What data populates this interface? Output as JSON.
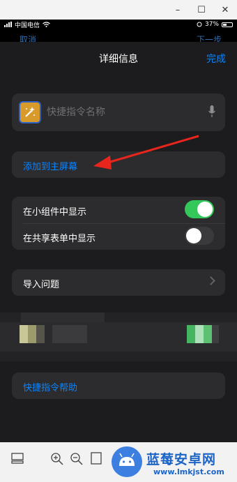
{
  "window": {
    "minimize": "–",
    "maximize": "☐",
    "close": "✕"
  },
  "status": {
    "carrier": "中国电信",
    "battery": "37%"
  },
  "behind": {
    "left": "取消",
    "right": "下一步"
  },
  "sheet": {
    "title": "详细信息",
    "done": "完成",
    "name_placeholder": "快捷指令名称",
    "add_home": "添加到主屏幕",
    "show_widget": "在小组件中显示",
    "show_widget_on": true,
    "show_share": "在共享表单中显示",
    "show_share_on": false,
    "import_questions": "导入问题",
    "help": "快捷指令帮助"
  },
  "colors": {
    "accent": "#0a84ff",
    "toggle_on": "#34c759",
    "icon_bg": "#d89b2b"
  },
  "watermark": {
    "title": "蓝莓安卓网",
    "url": "www.lmkjst.com"
  }
}
